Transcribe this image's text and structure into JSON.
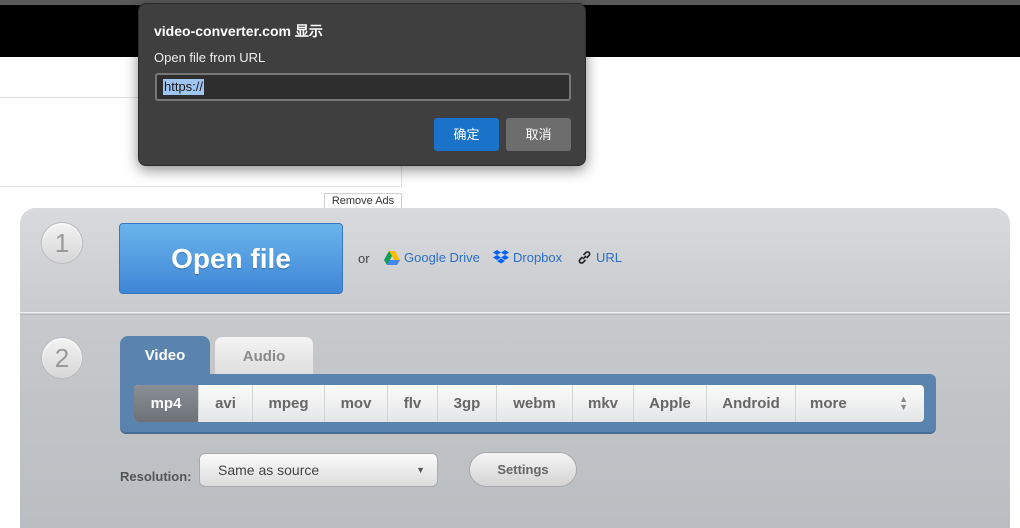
{
  "remove_ads_label": "Remove Ads",
  "step1": {
    "number": "1",
    "open_file_label": "Open file",
    "or_text": "or",
    "sources": [
      {
        "label": "Google Drive",
        "icon": "google-drive-icon"
      },
      {
        "label": "Dropbox",
        "icon": "dropbox-icon"
      },
      {
        "label": "URL",
        "icon": "link-icon"
      }
    ]
  },
  "step2": {
    "number": "2",
    "tabs": [
      {
        "label": "Video",
        "active": true
      },
      {
        "label": "Audio",
        "active": false
      }
    ],
    "formats": [
      "mp4",
      "avi",
      "mpeg",
      "mov",
      "flv",
      "3gp",
      "webm",
      "mkv",
      "Apple",
      "Android",
      "more"
    ],
    "selected_format": "mp4",
    "resolution_label": "Resolution:",
    "resolution_value": "Same as source",
    "settings_label": "Settings"
  },
  "dialog": {
    "title": "video-converter.com 显示",
    "message": "Open file from URL",
    "input_value": "https://",
    "ok_label": "确定",
    "cancel_label": "取消"
  },
  "colors": {
    "accent_blue": "#3f86d6",
    "tab_blue": "#5a84ad",
    "link_blue": "#2a6fc9",
    "dialog_bg": "#3f3f3f",
    "dialog_ok": "#1a73c8"
  }
}
